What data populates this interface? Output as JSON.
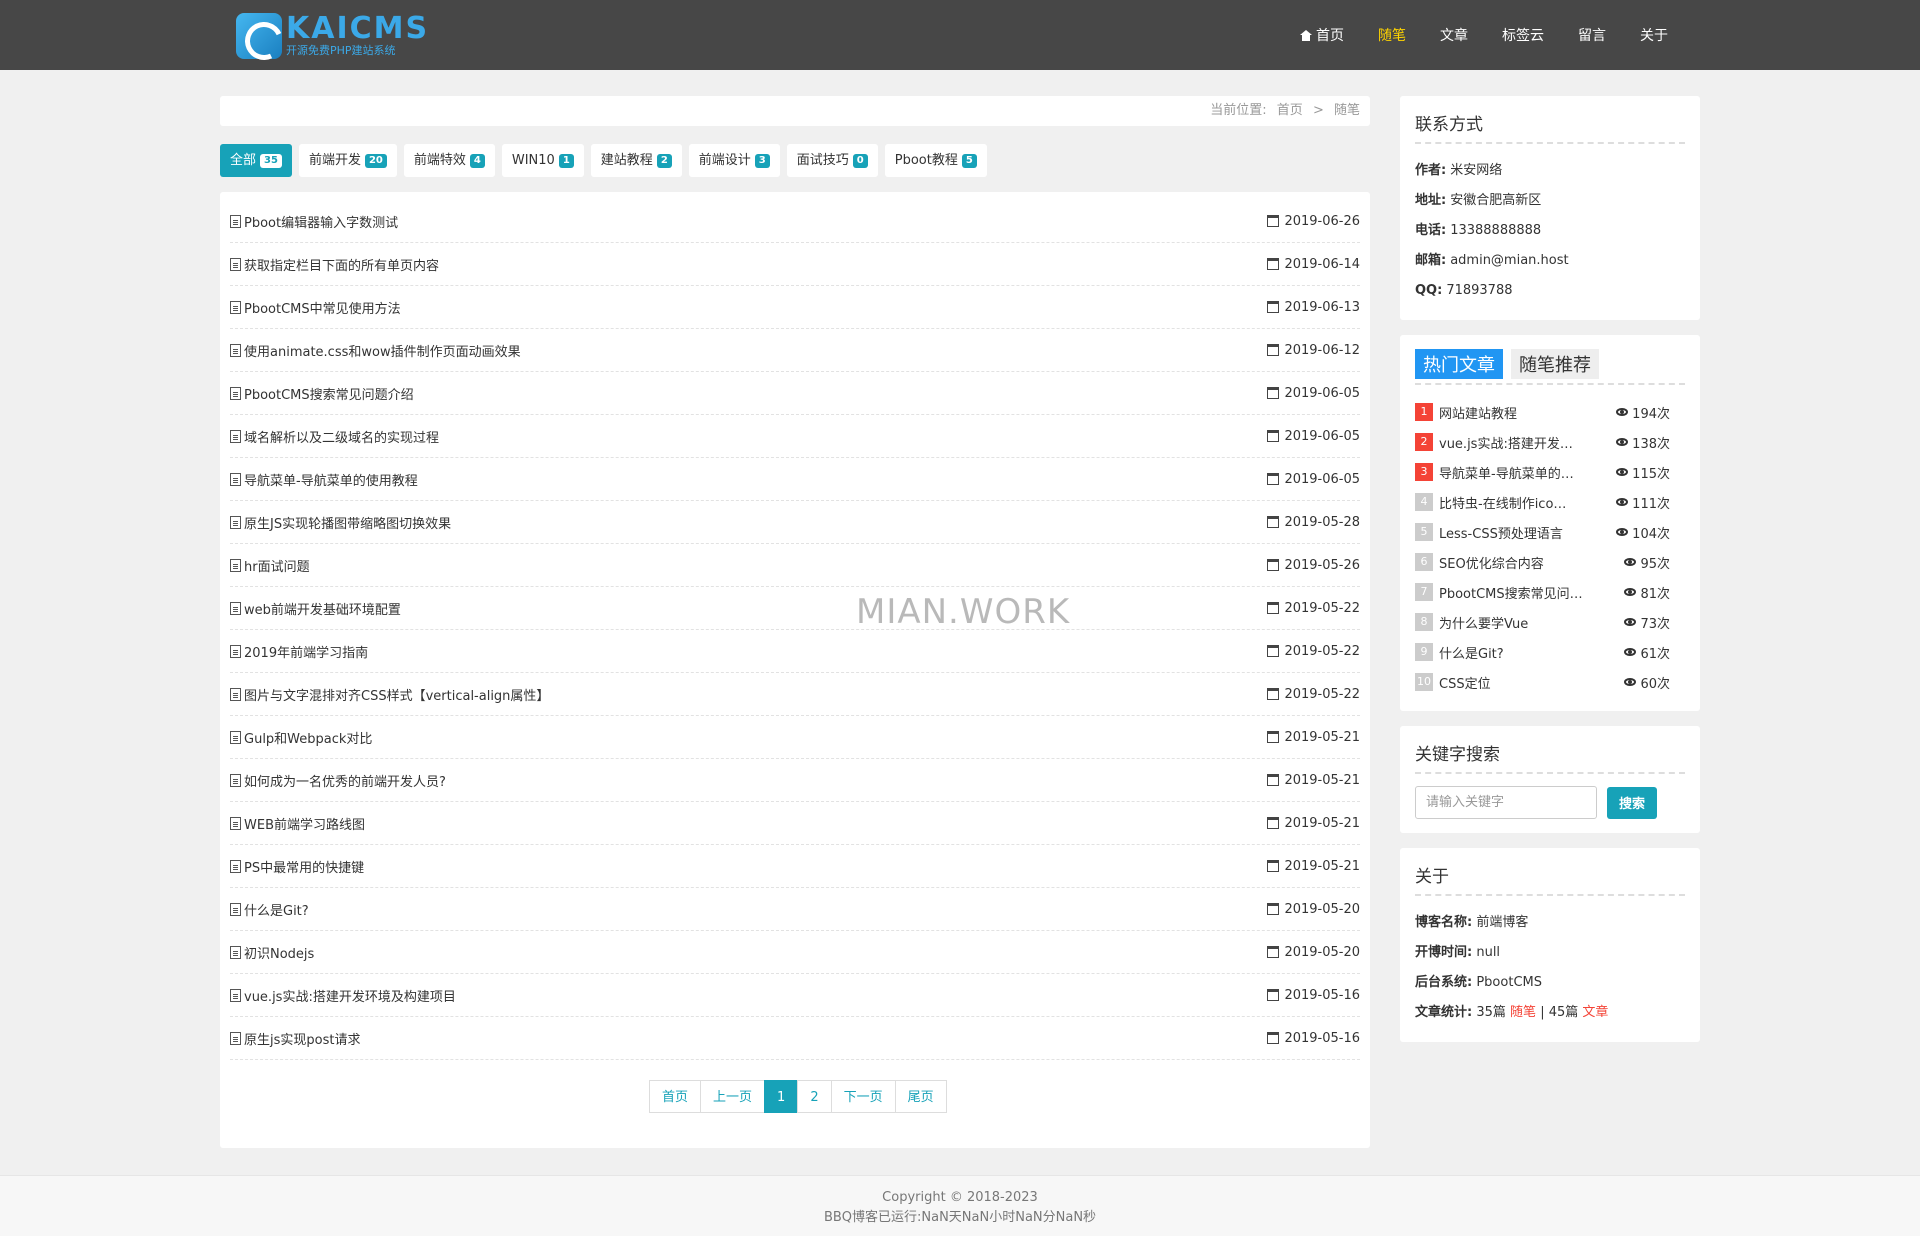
{
  "header": {
    "logo_title": "KAICMS",
    "logo_subtitle": "开源免费PHP建站系统",
    "nav": [
      {
        "label": "首页",
        "active": false,
        "icon": "home-icon"
      },
      {
        "label": "随笔",
        "active": true
      },
      {
        "label": "文章",
        "active": false
      },
      {
        "label": "标签云",
        "active": false
      },
      {
        "label": "留言",
        "active": false
      },
      {
        "label": "关于",
        "active": false
      }
    ]
  },
  "breadcrumb": {
    "prefix": "当前位置:",
    "home": "首页",
    "separator": ">",
    "current": "随笔"
  },
  "tags": [
    {
      "label": "全部",
      "count": "35",
      "active": true
    },
    {
      "label": "前端开发",
      "count": "20"
    },
    {
      "label": "前端特效",
      "count": "4"
    },
    {
      "label": "WIN10",
      "count": "1"
    },
    {
      "label": "建站教程",
      "count": "2"
    },
    {
      "label": "前端设计",
      "count": "3"
    },
    {
      "label": "面试技巧",
      "count": "0"
    },
    {
      "label": "Pboot教程",
      "count": "5"
    }
  ],
  "articles": [
    {
      "title": "Pboot编辑器输入字数测试",
      "date": "2019-06-26"
    },
    {
      "title": "获取指定栏目下面的所有单页内容",
      "date": "2019-06-14"
    },
    {
      "title": "PbootCMS中常见使用方法",
      "date": "2019-06-13"
    },
    {
      "title": "使用animate.css和wow插件制作页面动画效果",
      "date": "2019-06-12"
    },
    {
      "title": "PbootCMS搜索常见问题介绍",
      "date": "2019-06-05"
    },
    {
      "title": "域名解析以及二级域名的实现过程",
      "date": "2019-06-05"
    },
    {
      "title": "导航菜单-导航菜单的使用教程",
      "date": "2019-06-05"
    },
    {
      "title": "原生JS实现轮播图带缩略图切换效果",
      "date": "2019-05-28"
    },
    {
      "title": "hr面试问题",
      "date": "2019-05-26"
    },
    {
      "title": "web前端开发基础环境配置",
      "date": "2019-05-22"
    },
    {
      "title": "2019年前端学习指南",
      "date": "2019-05-22"
    },
    {
      "title": "图片与文字混排对齐CSS样式【vertical-align属性】",
      "date": "2019-05-22"
    },
    {
      "title": "Gulp和Webpack对比",
      "date": "2019-05-21"
    },
    {
      "title": "如何成为一名优秀的前端开发人员?",
      "date": "2019-05-21"
    },
    {
      "title": "WEB前端学习路线图",
      "date": "2019-05-21"
    },
    {
      "title": "PS中最常用的快捷键",
      "date": "2019-05-21"
    },
    {
      "title": "什么是Git?",
      "date": "2019-05-20"
    },
    {
      "title": "初识Nodejs",
      "date": "2019-05-20"
    },
    {
      "title": "vue.js实战:搭建开发环境及构建项目",
      "date": "2019-05-16"
    },
    {
      "title": "原生js实现post请求",
      "date": "2019-05-16"
    }
  ],
  "watermark": "MIAN.WORK",
  "pager": [
    {
      "label": "首页",
      "active": false
    },
    {
      "label": "上一页",
      "active": false
    },
    {
      "label": "1",
      "active": true
    },
    {
      "label": "2",
      "active": false
    },
    {
      "label": "下一页",
      "active": false
    },
    {
      "label": "尾页",
      "active": false
    }
  ],
  "contact": {
    "title": "联系方式",
    "rows": [
      {
        "key": "作者:",
        "value": "米安网络"
      },
      {
        "key": "地址:",
        "value": "安徽合肥高新区"
      },
      {
        "key": "电话:",
        "value": "13388888888"
      },
      {
        "key": "邮箱:",
        "value": "admin@mian.host"
      },
      {
        "key": "QQ:",
        "value": "71893788"
      }
    ]
  },
  "hot": {
    "tab_active": "热门文章",
    "tab_other": "随笔推荐",
    "items": [
      {
        "rank": "1",
        "title": "网站建站教程",
        "views": "194次"
      },
      {
        "rank": "2",
        "title": "vue.js实战:搭建开发…",
        "views": "138次"
      },
      {
        "rank": "3",
        "title": "导航菜单-导航菜单的…",
        "views": "115次"
      },
      {
        "rank": "4",
        "title": "比特虫-在线制作ico…",
        "views": "111次"
      },
      {
        "rank": "5",
        "title": "Less-CSS预处理语言",
        "views": "104次"
      },
      {
        "rank": "6",
        "title": "SEO优化综合内容",
        "views": "95次"
      },
      {
        "rank": "7",
        "title": "PbootCMS搜索常见问…",
        "views": "81次"
      },
      {
        "rank": "8",
        "title": "为什么要学Vue",
        "views": "73次"
      },
      {
        "rank": "9",
        "title": "什么是Git?",
        "views": "61次"
      },
      {
        "rank": "10",
        "title": "CSS定位",
        "views": "60次"
      }
    ]
  },
  "search": {
    "title": "关键字搜索",
    "placeholder": "请输入关键字",
    "button": "搜索"
  },
  "about": {
    "title": "关于",
    "blog_name_key": "博客名称:",
    "blog_name": "前端博客",
    "start_key": "开博时间:",
    "start": "null",
    "system_key": "后台系统:",
    "system": "PbootCMS",
    "stats_key": "文章统计:",
    "stats_count1": "35篇",
    "stats_link1": "随笔",
    "stats_sep": "|",
    "stats_count2": "45篇",
    "stats_link2": "文章"
  },
  "footer": {
    "copyright": "Copyright © 2018-2023",
    "runtime": "BBQ博客已运行:NaN天NaN小时NaN分NaN秒"
  },
  "colors": {
    "accent": "#17a2b8",
    "nav_active": "#ffd400",
    "header_bg": "#474747",
    "hot_tab": "#2196f3",
    "rank_top": "#f44336"
  }
}
